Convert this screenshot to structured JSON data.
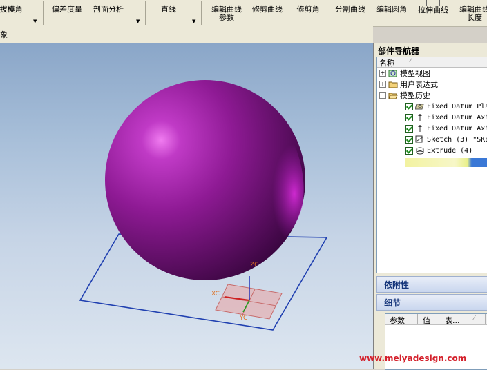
{
  "toolbar": {
    "buttons": [
      {
        "label": "拔模角"
      },
      {
        "label": "偏差度量"
      },
      {
        "label": "剖面分析"
      },
      {
        "label": "直线"
      },
      {
        "label": "编辑曲线参数",
        "line1": "编辑曲线",
        "line2": "参数"
      },
      {
        "label": "修剪曲线"
      },
      {
        "label": "修剪角"
      },
      {
        "label": "分割曲线"
      },
      {
        "label": "编辑圆角"
      },
      {
        "label": "拉伸曲线"
      },
      {
        "label": "编辑曲线长度",
        "line1": "编辑曲线",
        "line2": "长度"
      }
    ]
  },
  "subbar": {
    "text": "象"
  },
  "viewport": {
    "axes": {
      "z": "ZC",
      "x": "XC",
      "y": "YC"
    },
    "sphere_color": "#8e1a94",
    "plane_color": "#1f3fb0"
  },
  "navigator": {
    "title": "部件导航器",
    "column_header": "名称",
    "items": [
      {
        "label": "模型视图",
        "expander": "+"
      },
      {
        "label": "用户表达式",
        "expander": "+"
      },
      {
        "label": "模型历史",
        "expander": "−"
      },
      {
        "label": "Fixed Datum Pla",
        "checked": true
      },
      {
        "label": "Fixed Datum Axi",
        "checked": true
      },
      {
        "label": "Fixed Datum Axi",
        "checked": true
      },
      {
        "label": "Sketch (3) \"SKE",
        "checked": true
      },
      {
        "label": "Extrude (4)",
        "checked": true
      }
    ]
  },
  "dependencies": {
    "title": "依附性"
  },
  "details": {
    "title": "细节",
    "columns": [
      "参数",
      "值",
      "表..."
    ]
  },
  "watermark": "www.meiyadesign.com"
}
